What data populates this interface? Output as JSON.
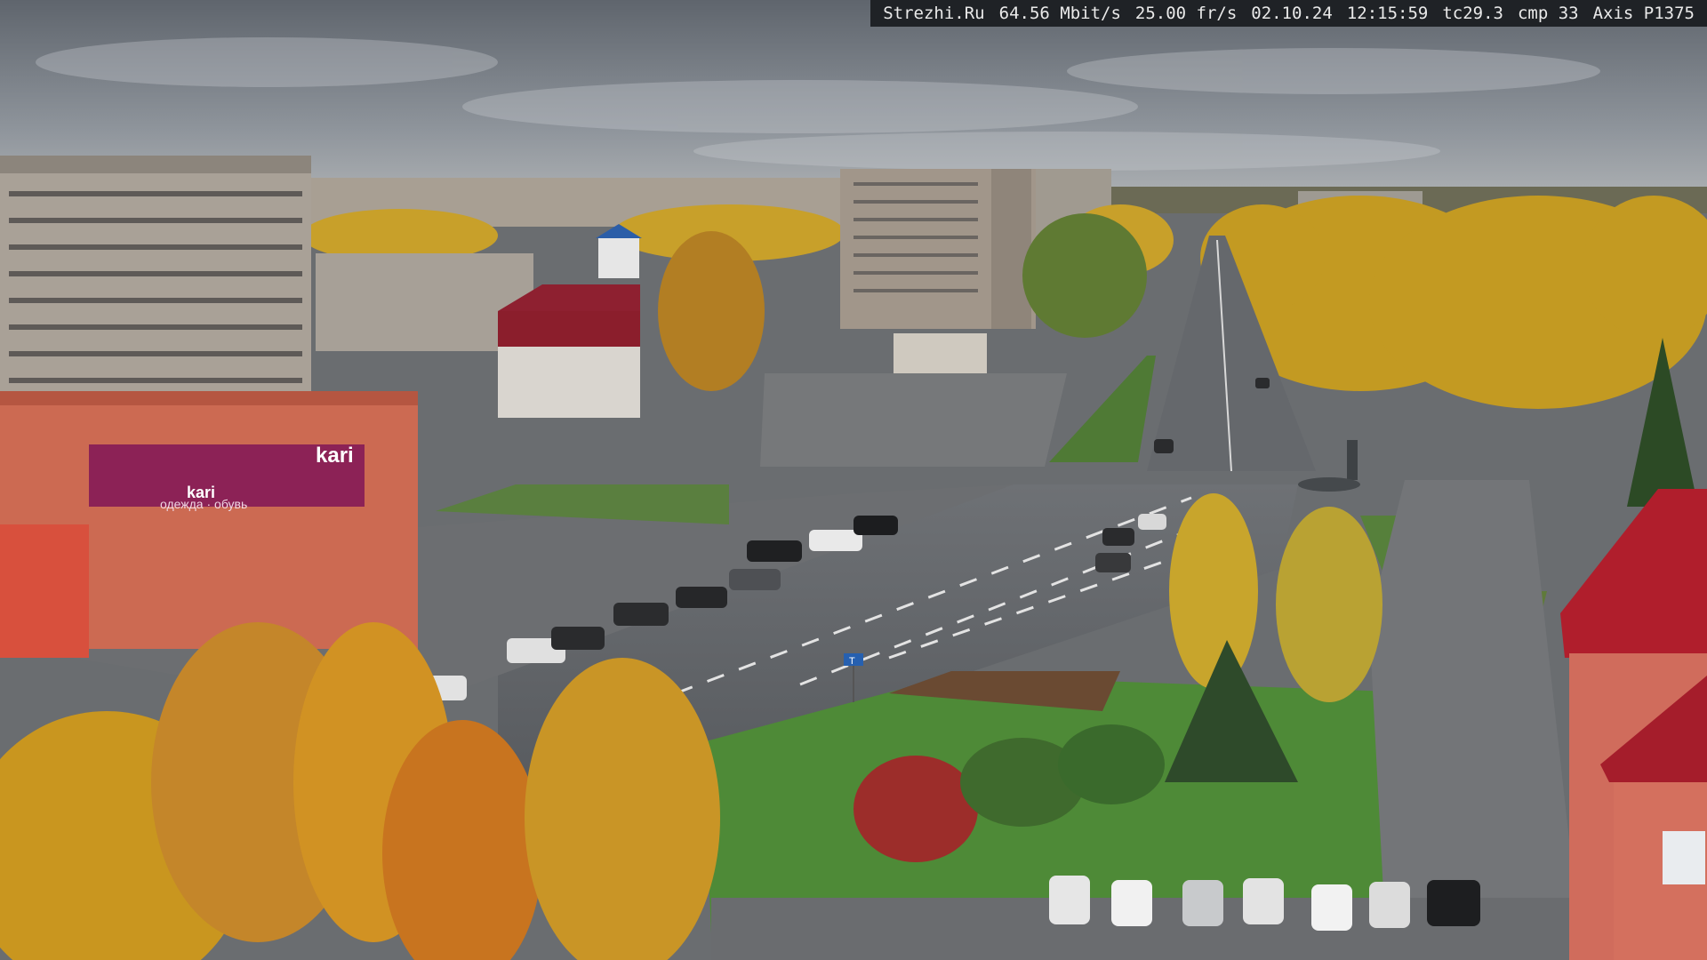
{
  "overlay": {
    "site": "Strezhi.Ru",
    "bitrate": "64.56 Mbit/s",
    "framerate": "25.00 fr/s",
    "date": "02.10.24",
    "time": "12:15:59",
    "tc": "tc29.3",
    "cmp": "cmp 33",
    "camera": "Axis P1375"
  },
  "signs": {
    "store_logo": "kari",
    "store_small_logo": "kari",
    "store_banner": "одежда · обувь",
    "street_sign": "Т"
  },
  "colors": {
    "sky": "#7d838b",
    "road": "#5f6266",
    "grass": "#4d7a3a",
    "foliage": "#c79a1f",
    "brick": "#c8624a",
    "store_banner": "#8c2256",
    "roof_red": "#b01e2c"
  }
}
